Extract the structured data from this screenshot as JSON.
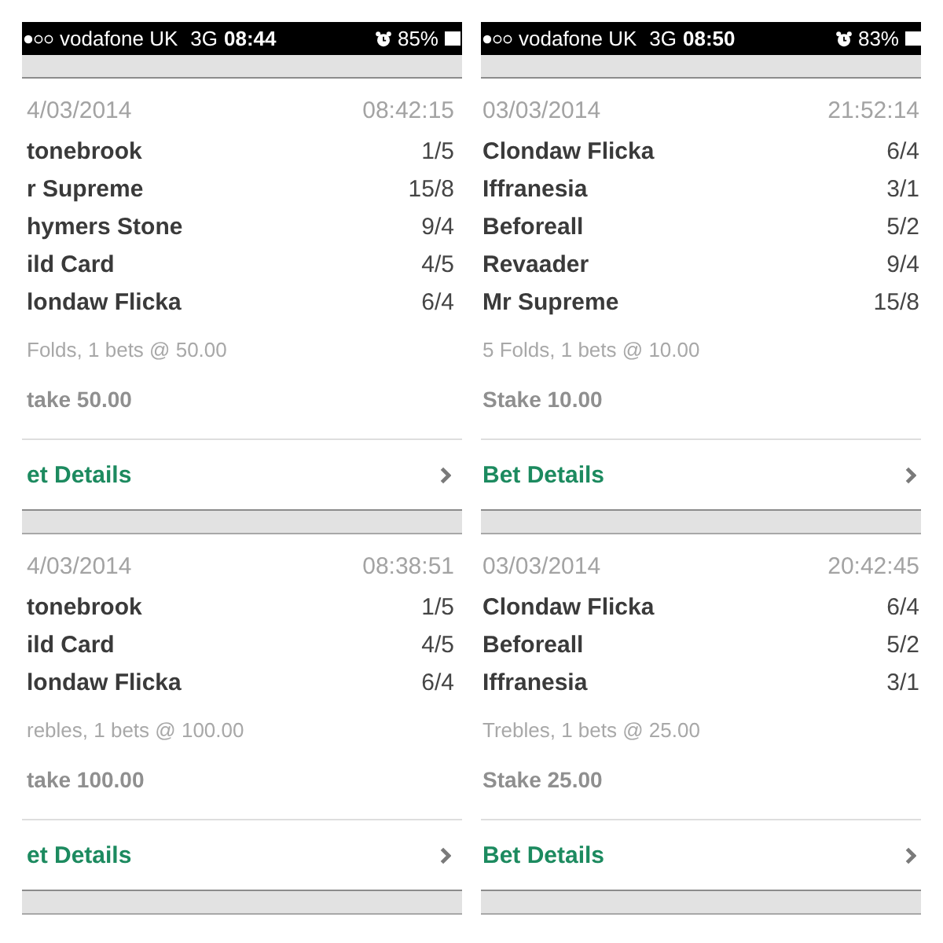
{
  "screens": [
    {
      "status_bar": {
        "carrier": "vodafone UK",
        "network": "3G",
        "time": "08:44",
        "battery": "85%"
      },
      "bets": [
        {
          "date": "4/03/2014",
          "time": "08:42:15",
          "selections": [
            {
              "name": "tonebrook",
              "odds": "1/5"
            },
            {
              "name": "r Supreme",
              "odds": "15/8"
            },
            {
              "name": "hymers Stone",
              "odds": "9/4"
            },
            {
              "name": "ild Card",
              "odds": "4/5"
            },
            {
              "name": "londaw Flicka",
              "odds": "6/4"
            }
          ],
          "summary": "Folds, 1 bets @ 50.00",
          "stake": "take 50.00",
          "details_link": "et Details"
        },
        {
          "date": "4/03/2014",
          "time": "08:38:51",
          "selections": [
            {
              "name": "tonebrook",
              "odds": "1/5"
            },
            {
              "name": "ild Card",
              "odds": "4/5"
            },
            {
              "name": "londaw Flicka",
              "odds": "6/4"
            }
          ],
          "summary": "rebles, 1 bets @ 100.00",
          "stake": "take 100.00",
          "details_link": "et Details"
        }
      ]
    },
    {
      "status_bar": {
        "carrier": "vodafone UK",
        "network": "3G",
        "time": "08:50",
        "battery": "83%"
      },
      "bets": [
        {
          "date": "03/03/2014",
          "time": "21:52:14",
          "selections": [
            {
              "name": "Clondaw Flicka",
              "odds": "6/4"
            },
            {
              "name": "Iffranesia",
              "odds": "3/1"
            },
            {
              "name": "Beforeall",
              "odds": "5/2"
            },
            {
              "name": "Revaader",
              "odds": "9/4"
            },
            {
              "name": "Mr Supreme",
              "odds": "15/8"
            }
          ],
          "summary": "5 Folds, 1 bets @ 10.00",
          "stake": "Stake 10.00",
          "details_link": "Bet Details"
        },
        {
          "date": "03/03/2014",
          "time": "20:42:45",
          "selections": [
            {
              "name": "Clondaw Flicka",
              "odds": "6/4"
            },
            {
              "name": "Beforeall",
              "odds": "5/2"
            },
            {
              "name": "Iffranesia",
              "odds": "3/1"
            }
          ],
          "summary": "Trebles, 1 bets @ 25.00",
          "stake": "Stake 25.00",
          "details_link": "Bet Details"
        }
      ]
    }
  ]
}
